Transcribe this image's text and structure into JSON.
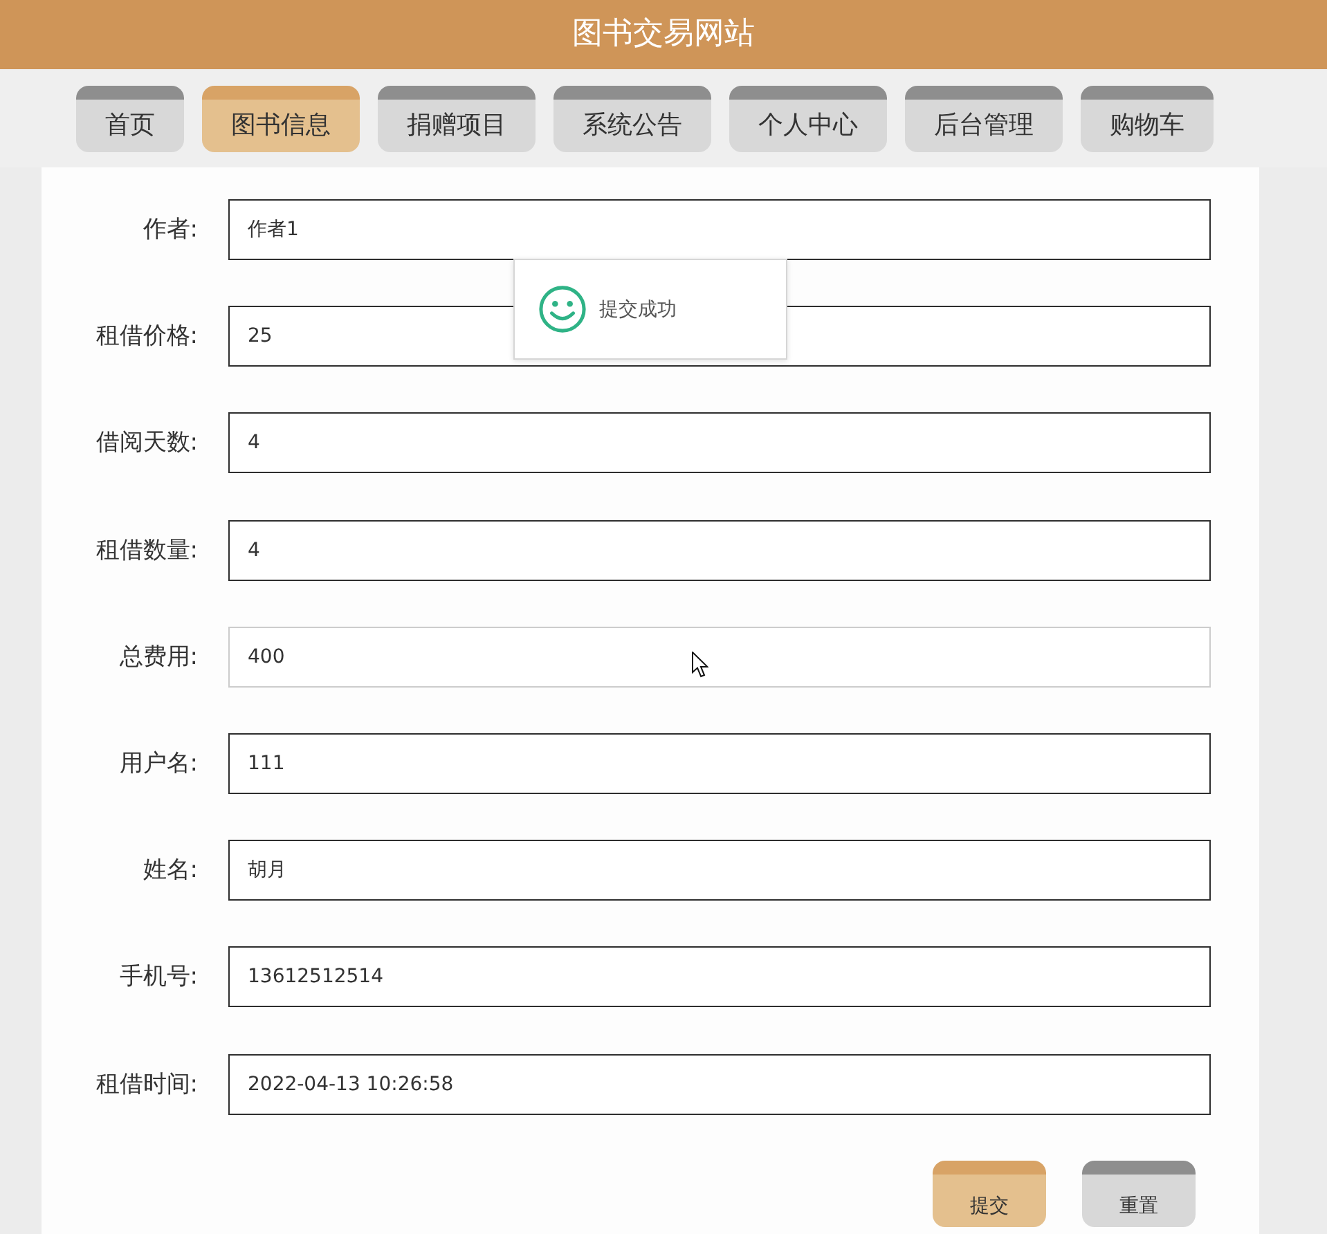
{
  "header": {
    "title": "图书交易网站"
  },
  "nav": {
    "tabs": [
      {
        "label": "首页",
        "selected": false
      },
      {
        "label": "图书信息",
        "selected": true
      },
      {
        "label": "捐赠项目",
        "selected": false
      },
      {
        "label": "系统公告",
        "selected": false
      },
      {
        "label": "个人中心",
        "selected": false
      },
      {
        "label": "后台管理",
        "selected": false
      },
      {
        "label": "购物车",
        "selected": false
      }
    ]
  },
  "form": {
    "fields": [
      {
        "label": "作者:",
        "value": "作者1",
        "readonly": false
      },
      {
        "label": "租借价格:",
        "value": "25",
        "readonly": false
      },
      {
        "label": "借阅天数:",
        "value": "4",
        "readonly": false
      },
      {
        "label": "租借数量:",
        "value": "4",
        "readonly": false
      },
      {
        "label": "总费用:",
        "value": "400",
        "readonly": true
      },
      {
        "label": "用户名:",
        "value": "111",
        "readonly": false
      },
      {
        "label": "姓名:",
        "value": "胡月",
        "readonly": false
      },
      {
        "label": "手机号:",
        "value": "13612512514",
        "readonly": false
      },
      {
        "label": "租借时间:",
        "value": "2022-04-13 10:26:58",
        "readonly": false
      }
    ],
    "buttons": [
      {
        "label": "提交",
        "kind": "primary"
      },
      {
        "label": "重置",
        "kind": "secondary"
      }
    ]
  },
  "toast": {
    "message": "提交成功"
  }
}
